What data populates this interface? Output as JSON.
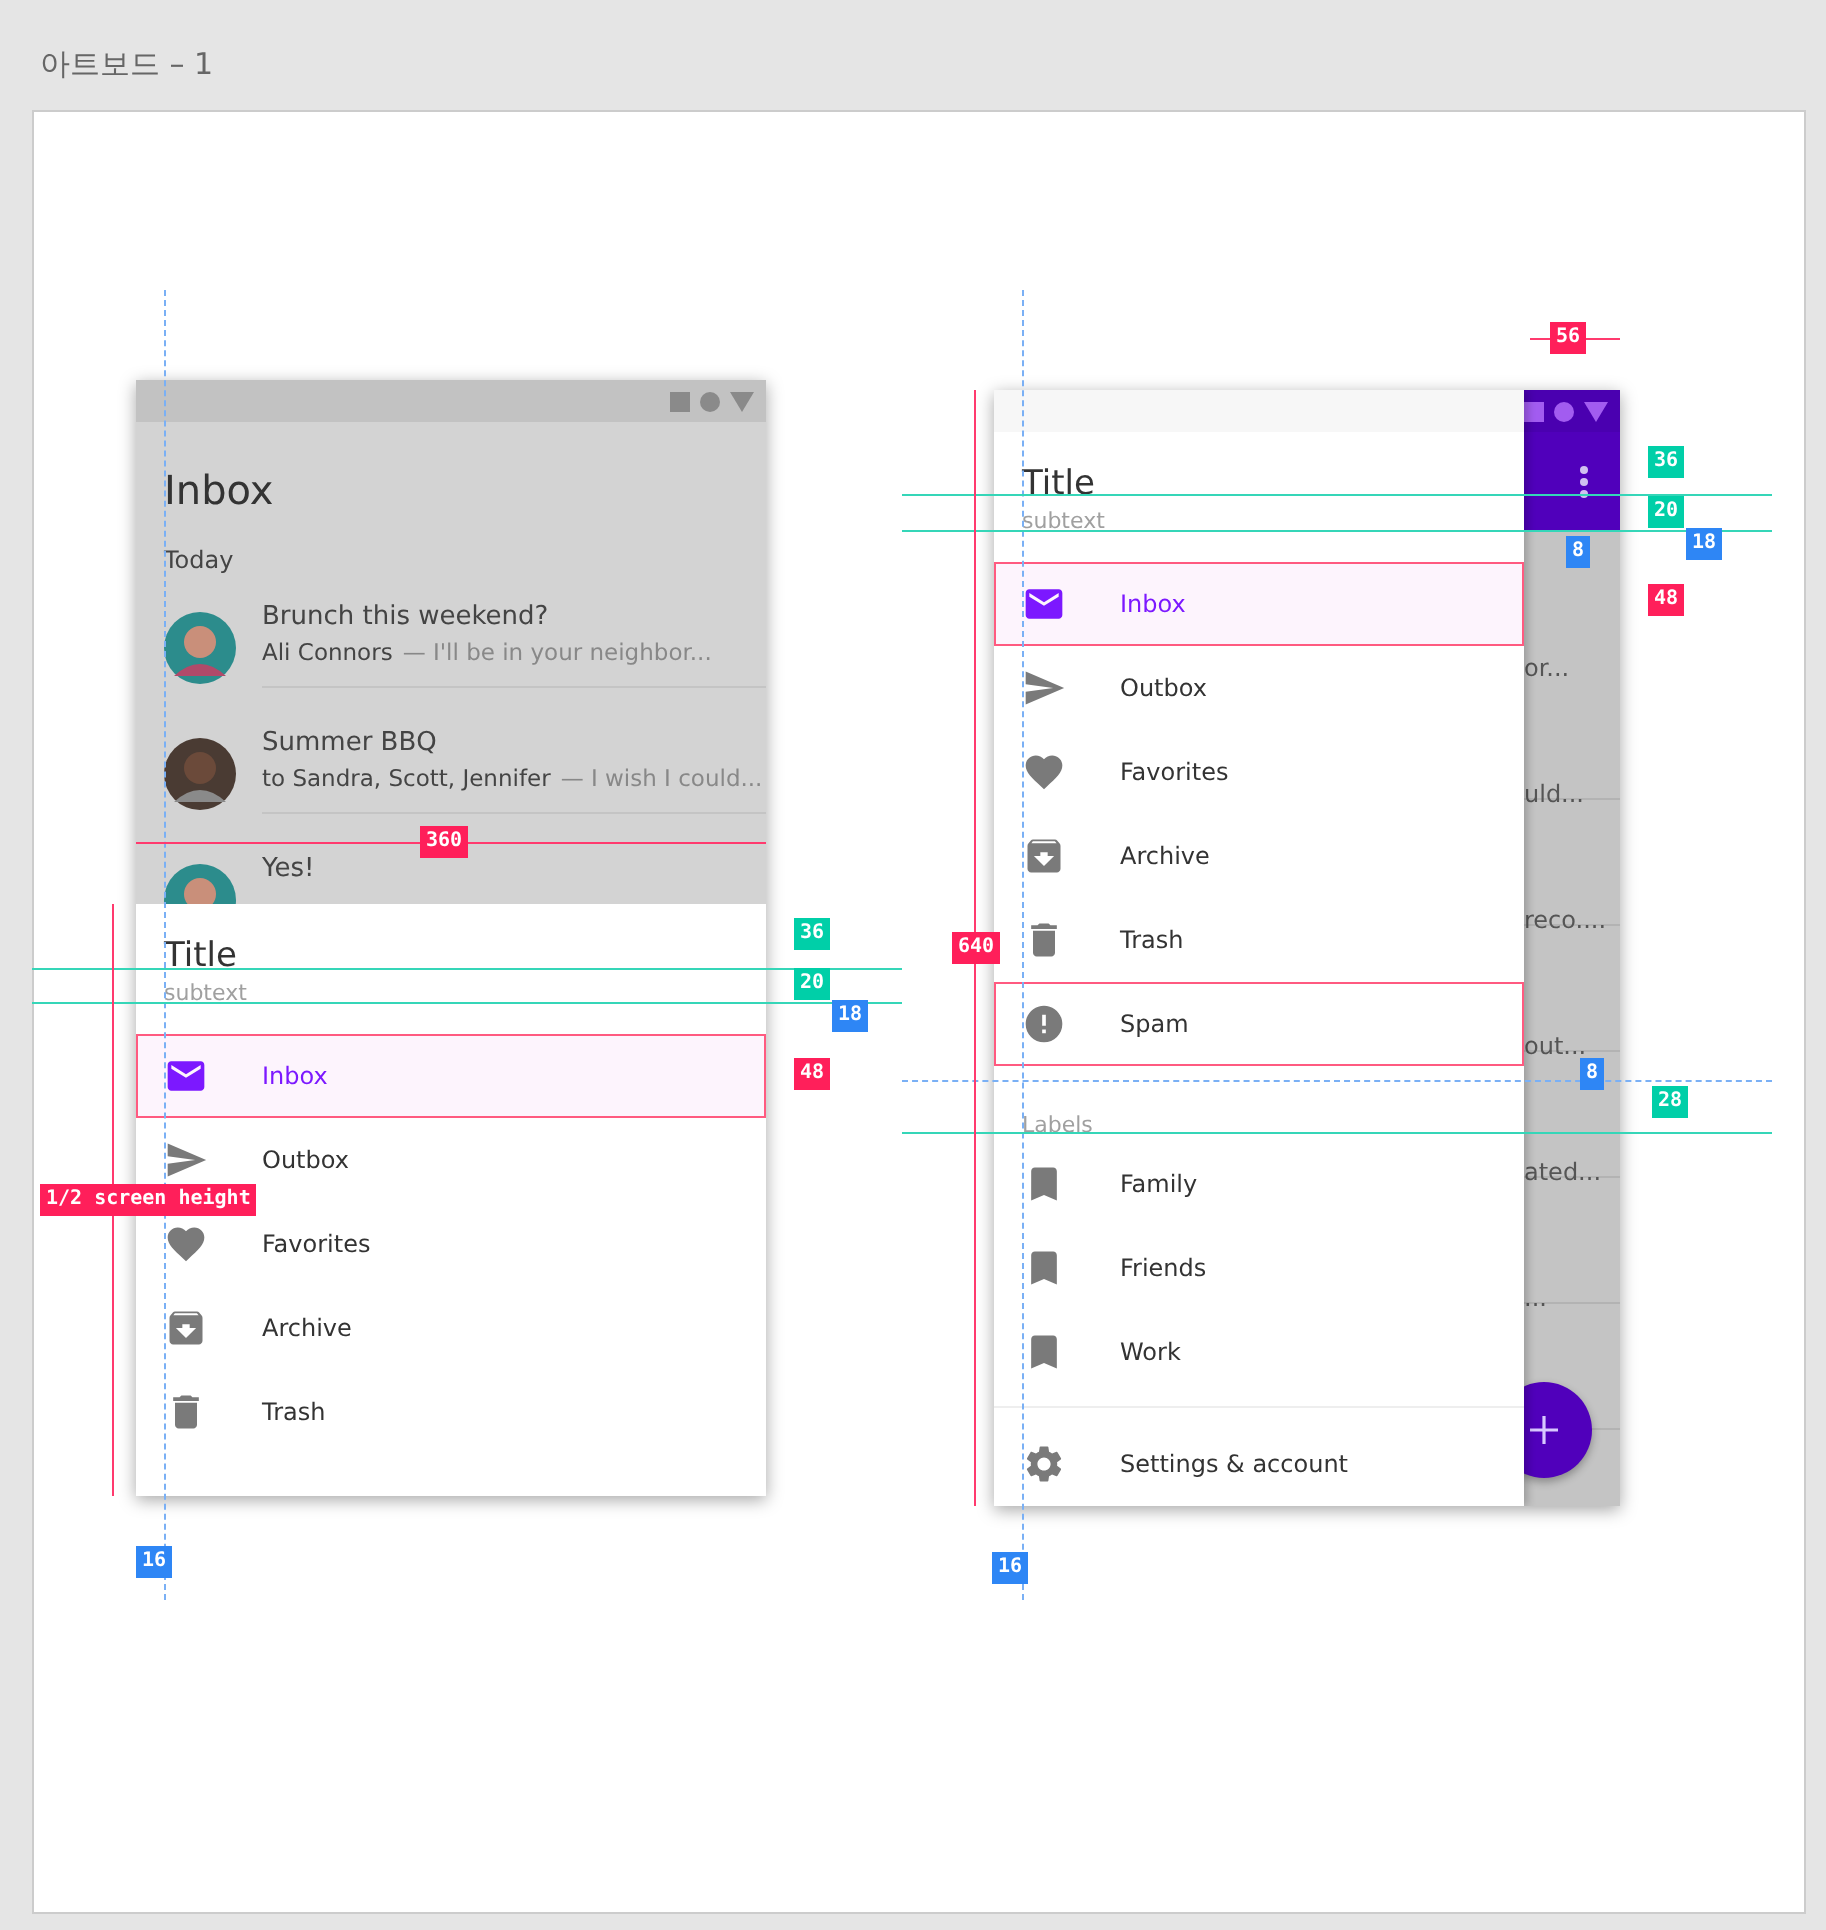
{
  "artboard": {
    "title": "아트보드 – 1"
  },
  "left_phone": {
    "inbox": {
      "title": "Inbox",
      "section": "Today",
      "messages": [
        {
          "subject": "Brunch this weekend?",
          "sender": "Ali Connors",
          "preview": "— I'll be in your neighbor..."
        },
        {
          "subject": "Summer BBQ",
          "sender": "to Sandra, Scott, Jennifer",
          "preview": "— I wish I could..."
        },
        {
          "subject": "Yes!"
        }
      ]
    },
    "drawer": {
      "title": "Title",
      "subtext": "subtext",
      "items": [
        {
          "label": "Inbox",
          "selected": true,
          "outlined": true
        },
        {
          "label": "Outbox",
          "selected": false,
          "outlined": false
        },
        {
          "label": "Favorites",
          "selected": false,
          "outlined": false
        },
        {
          "label": "Archive",
          "selected": false,
          "outlined": false
        },
        {
          "label": "Trash",
          "selected": false,
          "outlined": false
        }
      ]
    }
  },
  "right_phone": {
    "list_fragments": [
      "or...",
      "uld...",
      "reco....",
      "out...",
      "ated...",
      "..."
    ],
    "drawer": {
      "title": "Title",
      "subtext": "subtext",
      "items": [
        {
          "label": "Inbox",
          "selected": true,
          "outlined": true
        },
        {
          "label": "Outbox",
          "selected": false,
          "outlined": false
        },
        {
          "label": "Favorites",
          "selected": false,
          "outlined": false
        },
        {
          "label": "Archive",
          "selected": false,
          "outlined": false
        },
        {
          "label": "Trash",
          "selected": false,
          "outlined": false
        },
        {
          "label": "Spam",
          "selected": false,
          "outlined": true
        }
      ],
      "labels_header": "Labels",
      "labels": [
        {
          "label": "Family"
        },
        {
          "label": "Friends"
        },
        {
          "label": "Work"
        }
      ],
      "footer_item": {
        "label": "Settings & account"
      }
    }
  },
  "measurements": [
    {
      "text": "360",
      "kind": "red"
    },
    {
      "text": "36",
      "kind": "teal"
    },
    {
      "text": "20",
      "kind": "teal"
    },
    {
      "text": "18",
      "kind": "blue"
    },
    {
      "text": "48",
      "kind": "red"
    },
    {
      "text": "1/2 screen height",
      "kind": "red"
    },
    {
      "text": "16",
      "kind": "blue"
    },
    {
      "text": "56",
      "kind": "red"
    },
    {
      "text": "36",
      "kind": "teal"
    },
    {
      "text": "20",
      "kind": "teal"
    },
    {
      "text": "18",
      "kind": "blue"
    },
    {
      "text": "8",
      "kind": "blue"
    },
    {
      "text": "48",
      "kind": "red"
    },
    {
      "text": "640",
      "kind": "red"
    },
    {
      "text": "8",
      "kind": "blue"
    },
    {
      "text": "28",
      "kind": "teal"
    },
    {
      "text": "16",
      "kind": "blue"
    }
  ]
}
